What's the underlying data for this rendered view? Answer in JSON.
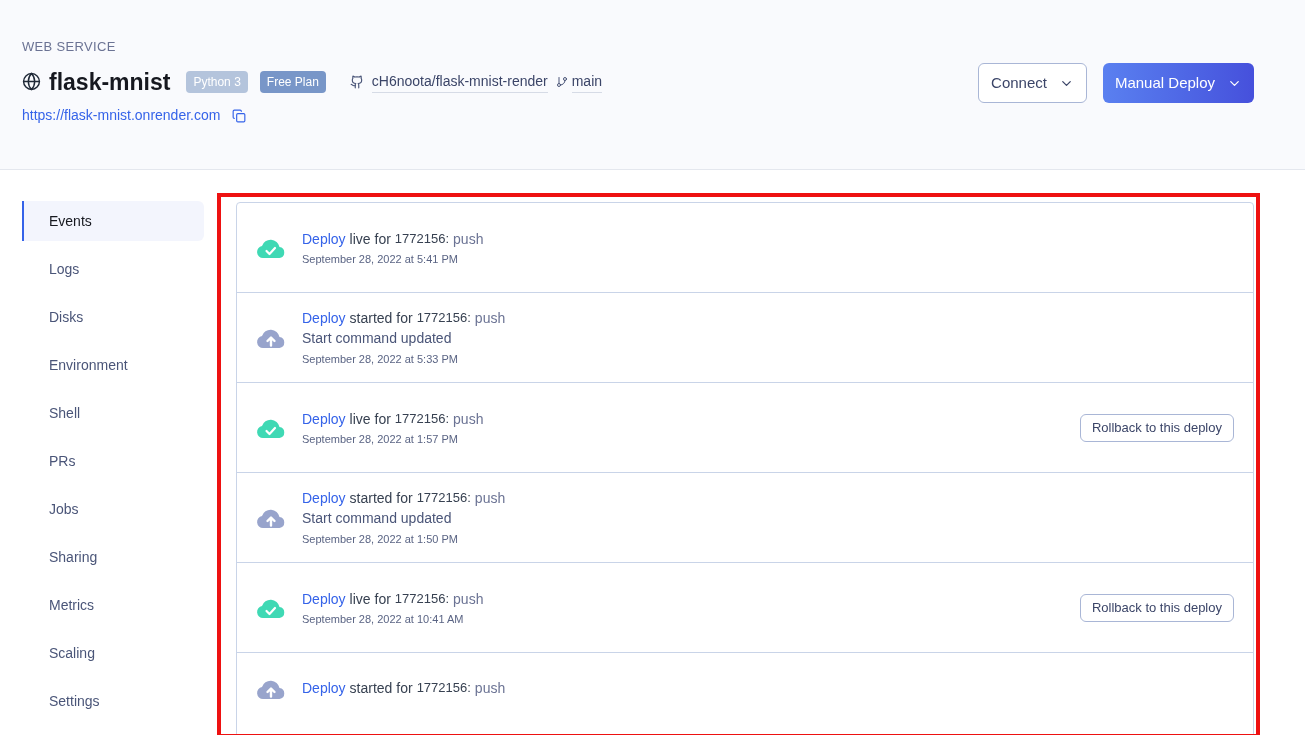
{
  "header": {
    "kicker": "WEB SERVICE",
    "title": "flask-mnist",
    "badges": [
      {
        "label": "Python 3",
        "color": "#b4c4dc"
      },
      {
        "label": "Free Plan",
        "color": "#7896c8"
      }
    ],
    "repo": "cH6noota/flask-mnist-render",
    "branch": "main",
    "url": "https://flask-mnist.onrender.com",
    "buttons": [
      {
        "label": "Connect",
        "kind": "outline"
      },
      {
        "label": "Manual Deploy",
        "kind": "primary"
      }
    ]
  },
  "sidebar": {
    "items": [
      {
        "label": "Events",
        "selected": true
      },
      {
        "label": "Logs",
        "selected": false
      },
      {
        "label": "Disks",
        "selected": false
      },
      {
        "label": "Environment",
        "selected": false
      },
      {
        "label": "Shell",
        "selected": false
      },
      {
        "label": "PRs",
        "selected": false
      },
      {
        "label": "Jobs",
        "selected": false
      },
      {
        "label": "Sharing",
        "selected": false
      },
      {
        "label": "Metrics",
        "selected": false
      },
      {
        "label": "Scaling",
        "selected": false
      },
      {
        "label": "Settings",
        "selected": false
      }
    ]
  },
  "events": [
    {
      "kind": "live",
      "link": "Deploy",
      "verb": "live for",
      "commit": "1772156:",
      "trigger": "push",
      "time": "September 28, 2022 at 5:41 PM"
    },
    {
      "kind": "started",
      "link": "Deploy",
      "verb": "started for",
      "commit": "1772156:",
      "trigger": "push",
      "detail": "Start command updated",
      "time": "September 28, 2022 at 5:33 PM"
    },
    {
      "kind": "live",
      "link": "Deploy",
      "verb": "live for",
      "commit": "1772156:",
      "trigger": "push",
      "time": "September 28, 2022 at 1:57 PM",
      "action": "Rollback to this deploy"
    },
    {
      "kind": "started",
      "link": "Deploy",
      "verb": "started for",
      "commit": "1772156:",
      "trigger": "push",
      "detail": "Start command updated",
      "time": "September 28, 2022 at 1:50 PM"
    },
    {
      "kind": "live",
      "link": "Deploy",
      "verb": "live for",
      "commit": "1772156:",
      "trigger": "push",
      "time": "September 28, 2022 at 10:41 AM",
      "action": "Rollback to this deploy"
    },
    {
      "kind": "started",
      "link": "Deploy",
      "verb": "started for",
      "commit": "1772156:",
      "trigger": "push"
    }
  ]
}
